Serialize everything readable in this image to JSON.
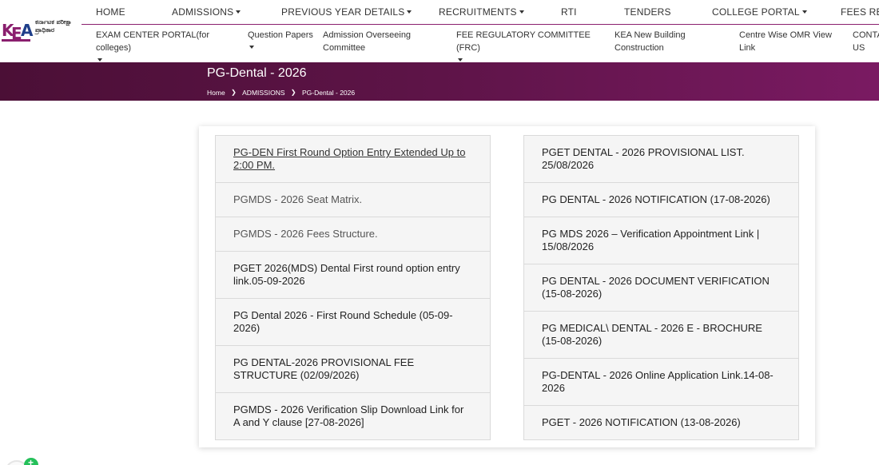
{
  "logo": {
    "mark": [
      "K",
      "E",
      "A"
    ],
    "kannada_text": "ಕರ್ನಾಟಕ ಪರೀಕ್ಷಾ ಪ್ರಾಧಿಕಾರ"
  },
  "top_nav": [
    {
      "label": "HOME"
    },
    {
      "label": "ADMISSIONS",
      "dropdown": true
    },
    {
      "label": "PREVIOUS YEAR DETAILS",
      "dropdown": true
    },
    {
      "label": "RECRUITMENTS",
      "dropdown": true
    },
    {
      "label": "RTI"
    },
    {
      "label": "TENDERS"
    },
    {
      "label": "COLLEGE PORTAL",
      "dropdown": true
    },
    {
      "label": "FEES REFU"
    }
  ],
  "sub_nav": [
    {
      "label": "EXAM CENTER PORTAL(for colleges)",
      "dropdown": true
    },
    {
      "label": "Question Papers",
      "dropdown": true
    },
    {
      "label": "Admission Overseeing Committee"
    },
    {
      "label": "FEE REGULATORY COMMITTEE (FRC)",
      "dropdown": true
    },
    {
      "label": "KEA New Building Construction"
    },
    {
      "label": "Centre Wise OMR View Link"
    },
    {
      "label": "CONTA US"
    }
  ],
  "banner": {
    "title": "PG-Dental - 2026",
    "breadcrumb": [
      "Home",
      "ADMISSIONS",
      "PG-Dental - 2026"
    ]
  },
  "left_list": [
    {
      "text": "PG-DEN First Round Option Entry Extended Up to 2:00 PM.",
      "style": "link"
    },
    {
      "text": "PGMDS - 2026 Seat Matrix.",
      "style": "muted"
    },
    {
      "text": "PGMDS - 2026 Fees Structure.",
      "style": "muted"
    },
    {
      "text": "PGET 2026(MDS) Dental First round option entry link.05-09-2026",
      "style": "normal"
    },
    {
      "text": "PG Dental 2026 - First Round Schedule (05-09-2026)",
      "style": "normal"
    },
    {
      "text": "PG DENTAL-2026 PROVISIONAL FEE STRUCTURE (02/09/2026)",
      "style": "normal"
    },
    {
      "text": "PGMDS - 2026 Verification Slip Download Link for A and Y clause [27-08-2026]",
      "style": "normal"
    }
  ],
  "right_list": [
    {
      "text": "PGET DENTAL - 2026 PROVISIONAL LIST. 25/08/2026",
      "style": "normal"
    },
    {
      "text": "PG DENTAL - 2026 NOTIFICATION (17-08-2026)",
      "style": "normal"
    },
    {
      "text": "PG MDS 2026 – Verification Appointment Link | 15/08/2026",
      "style": "normal"
    },
    {
      "text": "PG DENTAL - 2026 DOCUMENT VERIFICATION (15-08-2026)",
      "style": "normal"
    },
    {
      "text": "PG MEDICAL\\ DENTAL - 2026 E - BROCHURE (15-08-2026)",
      "style": "normal"
    },
    {
      "text": "PG-DENTAL - 2026 Online Application Link.14-08-2026",
      "style": "normal"
    },
    {
      "text": "PGET - 2026 NOTIFICATION (13-08-2026)",
      "style": "normal"
    }
  ],
  "colors": {
    "brand_purple": "#8a1f6e",
    "banner_dark": "#4b0f36",
    "banner_light": "#7a1a62",
    "list_bg": "#f5f5f5",
    "chat_green": "#25c05a"
  },
  "icons": {
    "caret": "chevron-down-icon",
    "breadcrumb_separator": "chevron-right-icon",
    "chat": "chat-widget-icon"
  }
}
